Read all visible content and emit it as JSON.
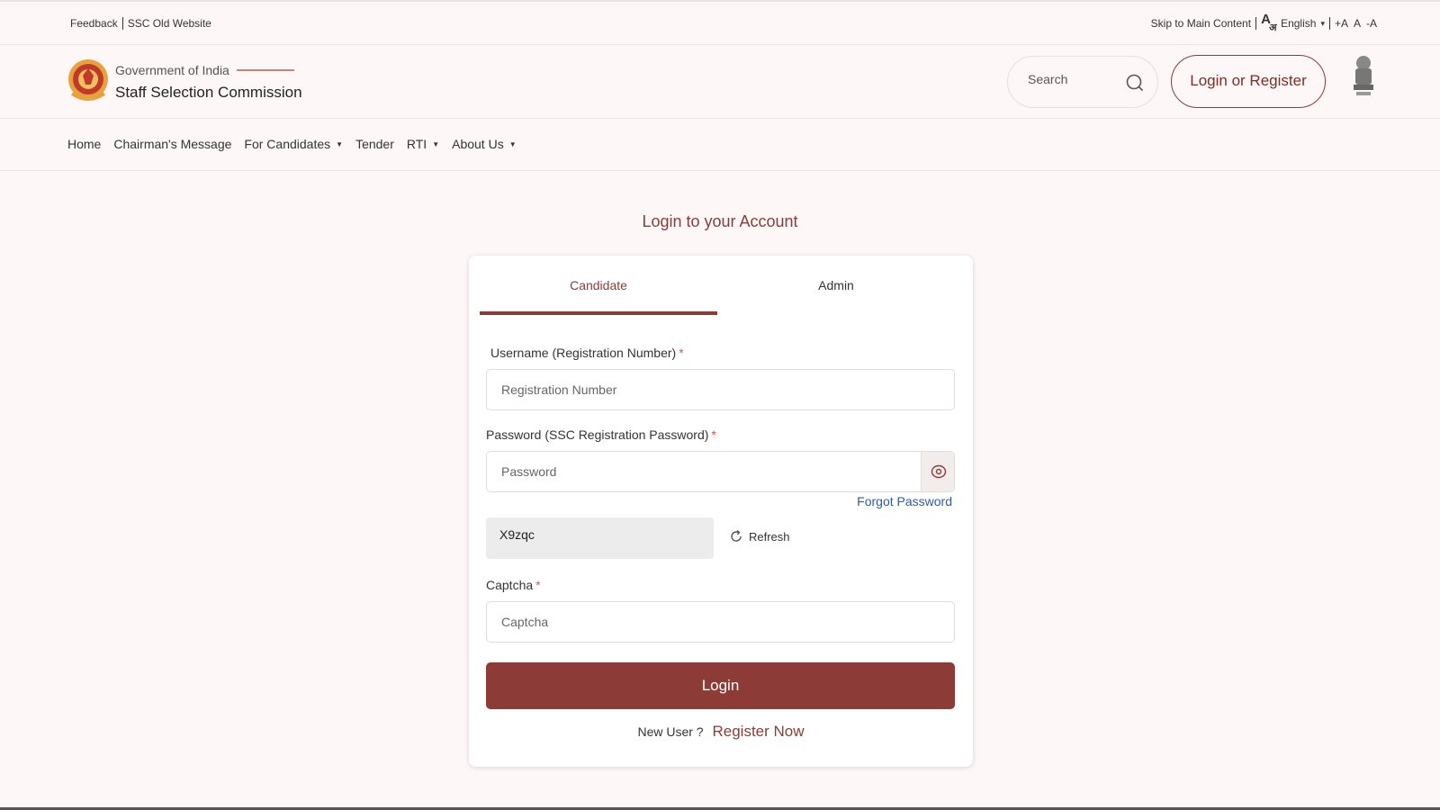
{
  "topbar": {
    "feedback": "Feedback",
    "old_website": "SSC Old Website",
    "skip": "Skip to Main Content",
    "language_icon": "language-icon",
    "language": "English",
    "font_increase": "+A",
    "font_normal": "A",
    "font_decrease": "-A"
  },
  "header": {
    "gov": "Government of India",
    "title": "Staff Selection Commission",
    "search_placeholder": "Search",
    "login_register": "Login or Register"
  },
  "nav": {
    "items": [
      {
        "label": "Home"
      },
      {
        "label": "Chairman's Message"
      },
      {
        "label": "For Candidates"
      },
      {
        "label": "Tender"
      },
      {
        "label": "RTI"
      },
      {
        "label": "About Us"
      }
    ]
  },
  "login": {
    "title": "Login to your Account",
    "tabs": [
      {
        "label": "Candidate"
      },
      {
        "label": "Admin"
      }
    ],
    "username_label": "Username (Registration Number)",
    "username_placeholder": "Registration Number",
    "password_label": "Password (SSC Registration Password)",
    "password_placeholder": "Password",
    "required_mark": "*",
    "forgot": "Forgot Password",
    "captcha_text": "X9zqc",
    "refresh": "Refresh",
    "captcha_label": "Captcha",
    "captcha_placeholder": "Captcha",
    "login_button": "Login",
    "new_user": "New User ?",
    "register": "Register Now"
  },
  "colors": {
    "primary": "#8c3b37",
    "link": "#2a5aa8",
    "background": "#fdf8f7"
  }
}
